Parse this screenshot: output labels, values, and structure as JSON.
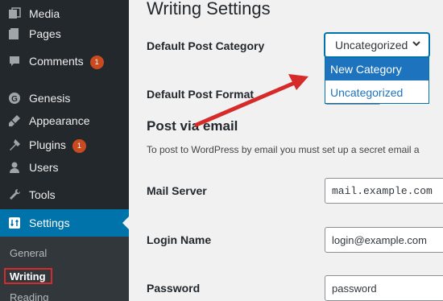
{
  "sidebar": {
    "items": [
      {
        "label": "Media",
        "icon": "media-icon"
      },
      {
        "label": "Pages",
        "icon": "pages-icon"
      },
      {
        "label": "Comments",
        "icon": "comments-icon",
        "badge": "1"
      },
      {
        "label": "Genesis",
        "icon": "genesis-icon"
      },
      {
        "label": "Appearance",
        "icon": "appearance-icon"
      },
      {
        "label": "Plugins",
        "icon": "plugins-icon",
        "badge": "1"
      },
      {
        "label": "Users",
        "icon": "users-icon"
      },
      {
        "label": "Tools",
        "icon": "tools-icon"
      },
      {
        "label": "Settings",
        "icon": "settings-icon"
      }
    ],
    "submenu": [
      "General",
      "Writing",
      "Reading"
    ]
  },
  "page": {
    "title": "Writing Settings",
    "default_post_category_label": "Default Post Category",
    "default_post_category_value": "Uncategorized",
    "dropdown_options": [
      "New Category",
      "Uncategorized"
    ],
    "default_post_format_label": "Default Post Format",
    "post_via_email_title": "Post via email",
    "post_via_email_desc": "To post to WordPress by email you must set up a secret email a",
    "mail_server_label": "Mail Server",
    "mail_server_value": "mail.example.com",
    "login_name_label": "Login Name",
    "login_name_value": "login@example.com",
    "password_label": "Password",
    "password_value": "password"
  },
  "colors": {
    "sidebar_bg": "#23282d",
    "accent": "#0073aa",
    "badge": "#ca4a1f",
    "annotation": "#d62b2b"
  }
}
